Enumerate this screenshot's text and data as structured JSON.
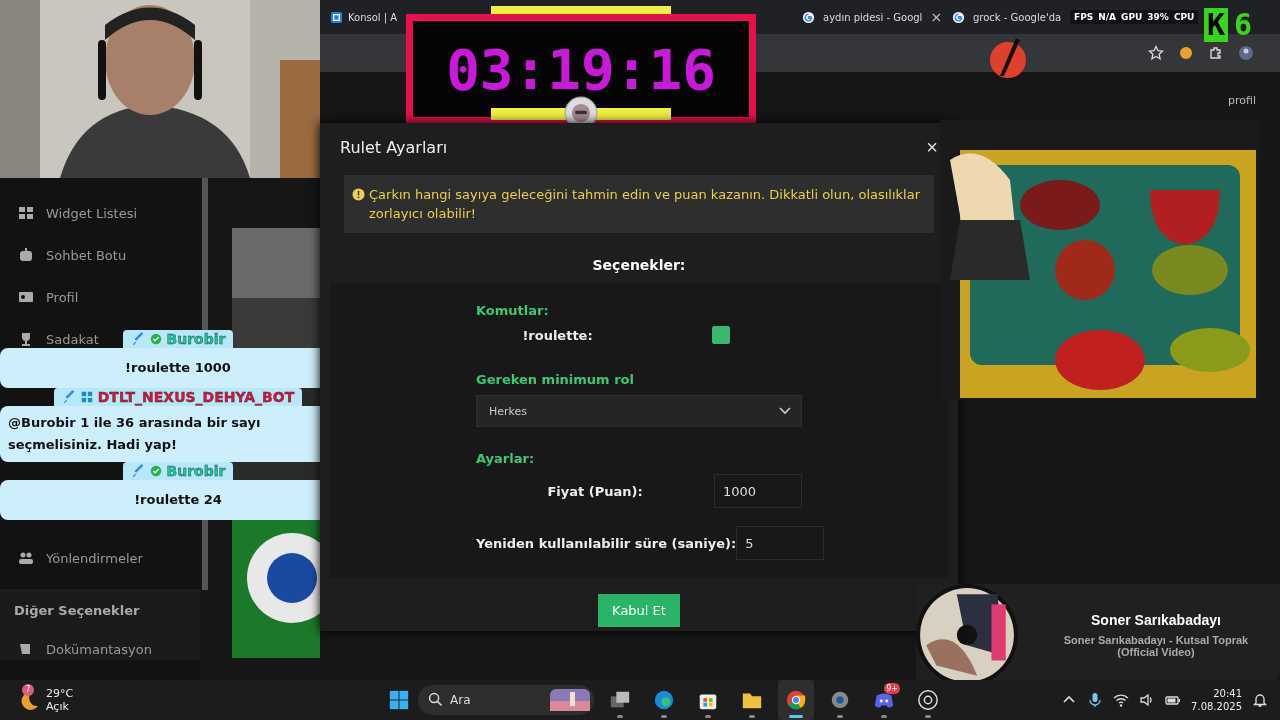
{
  "browser": {
    "tabs": [
      {
        "title": "Konsol | A",
        "kind": "box",
        "closable": false
      },
      {
        "title": "aydın pidesi - Googl",
        "kind": "google",
        "closable": true
      },
      {
        "title": "grock - Google'da",
        "kind": "google"
      }
    ],
    "close": "×"
  },
  "timer": {
    "time": "03:19:16"
  },
  "stats": [
    {
      "label": "FPS",
      "value": "N/A"
    },
    {
      "label": "GPU",
      "value": "39%"
    },
    {
      "label": "CPU"
    }
  ],
  "logo": {
    "letter": "K",
    "digit": "6"
  },
  "profile_link": "profil",
  "sidebar": {
    "items": [
      {
        "label": "Widget Listesi",
        "kind": "grid"
      },
      {
        "label": "Sohbet Botu",
        "kind": "robot"
      },
      {
        "label": "Profil",
        "kind": "card"
      },
      {
        "label": "Sadakat",
        "kind": "trophy"
      },
      {
        "label": "Yönlendirmeler",
        "kind": "users"
      }
    ],
    "section": "Diğer Seçenekler",
    "section_items": [
      {
        "label": "Dokümantasyon",
        "kind": "scroll"
      }
    ]
  },
  "chat": [
    {
      "user": "Burobir",
      "kind": "user",
      "color": "#19c9a0",
      "text": "!roulette 1000"
    },
    {
      "user": "DTLT_NEXUS_DEHYA_BOT",
      "kind": "bot",
      "color": "#e0103c",
      "text": "@Burobir 1 ile 36 arasında bir sayı seçmelisiniz. Hadi yap!"
    },
    {
      "user": "Burobir",
      "kind": "user",
      "color": "#19c9a0",
      "text": "!roulette 24"
    }
  ],
  "modal": {
    "title": "Rulet Ayarları",
    "close": "×",
    "alert": "Çarkın hangi sayıya geleceğini tahmin edin ve puan kazanın. Dikkatli olun, olasılıklar zorlayıcı olabilir!",
    "options_heading": "Seçenekler:",
    "commands_label": "Komutlar:",
    "command": {
      "name": "!roulette:",
      "checked": true
    },
    "role_label": "Gereken minimum rol",
    "role_value": "Herkes",
    "settings_label": "Ayarlar:",
    "fields": [
      {
        "label": "Fiyat (Puan):",
        "value": "1000"
      },
      {
        "label": "Yeniden kullanılabilir süre (saniye):",
        "value": "5"
      }
    ],
    "submit": "Kabul Et"
  },
  "now_playing": {
    "artist": "Soner Sarıkabadayı",
    "title": "Soner Sarıkabadayı - Kutsal Toprak (Official Video)"
  },
  "taskbar": {
    "weather": {
      "temp": "29°C",
      "condition": "Açık",
      "badge": "7"
    },
    "search_placeholder": "Ara",
    "apps": [
      {
        "kind": "taskview",
        "active": false
      },
      {
        "kind": "edge",
        "active": false
      },
      {
        "kind": "store",
        "active": false
      },
      {
        "kind": "folder",
        "active": false
      },
      {
        "kind": "chrome",
        "active": true
      },
      {
        "kind": "settings",
        "active": false
      },
      {
        "kind": "discord",
        "active": false,
        "badge": "9+"
      },
      {
        "kind": "obs",
        "active": false
      }
    ],
    "time": "20:41",
    "date": "7.08.2025"
  }
}
